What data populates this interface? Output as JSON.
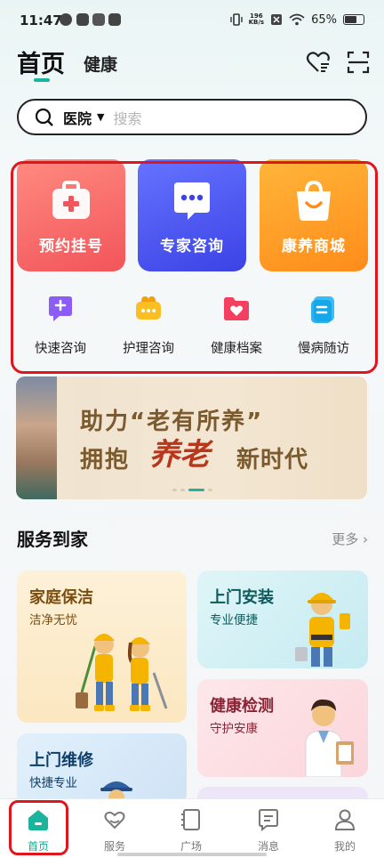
{
  "status_bar": {
    "time": "11:47",
    "net_speed_top": "196",
    "net_speed_bottom": "KB/s",
    "battery": "65%"
  },
  "header": {
    "tab_home": "首页",
    "tab_health": "健康",
    "accent": "#1ab39b"
  },
  "search": {
    "location": "医院",
    "placeholder": "搜索"
  },
  "quick_services": {
    "big": [
      {
        "label": "预约挂号",
        "icon": "medical-kit-icon"
      },
      {
        "label": "专家咨询",
        "icon": "chat-bubble-icon"
      },
      {
        "label": "康养商城",
        "icon": "shopping-bag-icon"
      }
    ],
    "small": [
      {
        "label": "快速咨询",
        "icon": "quick-chat-icon"
      },
      {
        "label": "护理咨询",
        "icon": "nurse-chat-icon"
      },
      {
        "label": "健康档案",
        "icon": "health-folder-icon"
      },
      {
        "label": "慢病随访",
        "icon": "followup-doc-icon"
      }
    ]
  },
  "banner": {
    "line1": "助力“老有所养”",
    "line2_a": "拥抱",
    "line2_b": "养老",
    "line2_c": "新时代"
  },
  "section": {
    "title": "服务到家",
    "more": "更多 ›"
  },
  "service_cards": [
    {
      "title": "家庭保洁",
      "subtitle": "洁净无忧"
    },
    {
      "title": "上门安装",
      "subtitle": "专业便捷"
    },
    {
      "title": "健康检测",
      "subtitle": "守护安康"
    },
    {
      "title": "上门维修",
      "subtitle": "快捷专业"
    }
  ],
  "bottom_nav": [
    {
      "label": "首页",
      "icon": "home-icon",
      "active": true
    },
    {
      "label": "服务",
      "icon": "heart-hands-icon"
    },
    {
      "label": "广场",
      "icon": "book-icon"
    },
    {
      "label": "消息",
      "icon": "message-icon"
    },
    {
      "label": "我的",
      "icon": "profile-icon"
    }
  ]
}
